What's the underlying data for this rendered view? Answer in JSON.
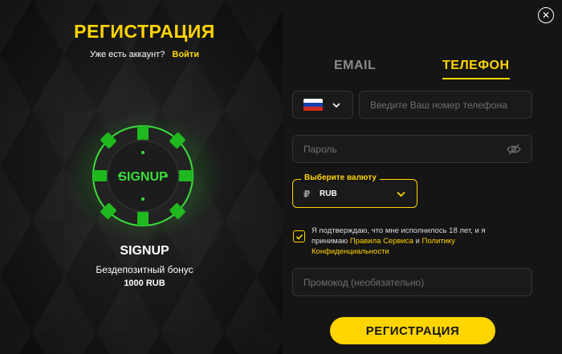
{
  "left": {
    "title": "РЕГИСТРАЦИЯ",
    "have_account_text": "Уже есть аккаунт?",
    "login_link": "Войти",
    "chip_text": "SIGNUP",
    "promo_name": "SIGNUP",
    "promo_bonus": "Бездепозитный бонус",
    "promo_amount": "1000 RUB"
  },
  "tabs": [
    {
      "label": "EMAIL",
      "active": false
    },
    {
      "label": "ТЕЛЕФОН",
      "active": true
    }
  ],
  "form": {
    "phone_placeholder": "Введите Ваш номер телефона",
    "password_placeholder": "Пароль",
    "currency_label": "Выберите валюту",
    "currency_symbol": "₽",
    "currency_value": "RUB",
    "terms_part1": "Я подтверждаю, что мне исполнилось 18 лет, и я принимаю ",
    "terms_link1": "Правила Сервиса",
    "terms_and": " и ",
    "terms_link2": "Политику Конфиденциальности",
    "promo_placeholder": "Промокод (необязательно)",
    "submit_label": "РЕГИСТРАЦИЯ"
  },
  "colors": {
    "accent": "#ffd500",
    "chip_green": "#3cdc3c",
    "flag_white": "#ffffff",
    "flag_blue": "#1a3fb0",
    "flag_red": "#d52b1e"
  },
  "icons": {
    "close": "close-icon",
    "eye": "eye-off-icon",
    "chevron": "chevron-down-icon",
    "check": "check-icon"
  }
}
